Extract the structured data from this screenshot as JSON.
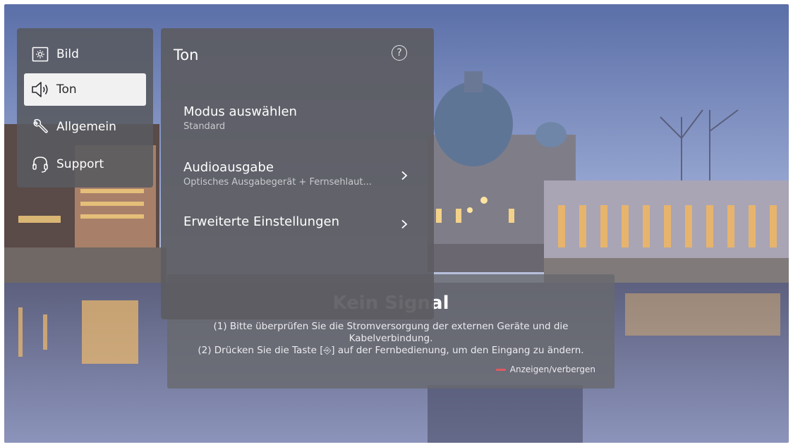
{
  "left_menu": {
    "items": [
      {
        "label": "Bild",
        "icon": "picture-settings-icon",
        "selected": false
      },
      {
        "label": "Ton",
        "icon": "speaker-icon",
        "selected": true
      },
      {
        "label": "Allgemein",
        "icon": "wrench-icon",
        "selected": false
      },
      {
        "label": "Support",
        "icon": "headset-icon",
        "selected": false
      }
    ]
  },
  "panel": {
    "title": "Ton",
    "help_glyph": "?",
    "rows": [
      {
        "label": "Modus auswählen",
        "value": "Standard",
        "has_arrow": false
      },
      {
        "label": "Audioausgabe",
        "value": "Optisches Ausgabegerät + Fernsehlaut...",
        "has_arrow": true
      },
      {
        "label": "Erweiterte Einstellungen",
        "value": "",
        "has_arrow": true
      }
    ]
  },
  "no_signal": {
    "title": "Kein Signal",
    "line1": "(1) Bitte überprüfen Sie die Stromversorgung der externen Geräte und die Kabelverbindung.",
    "line2": "(2) Drücken Sie die Taste [⎆] auf der Fernbedienung, um den Eingang zu ändern.",
    "toggle_label": "Anzeigen/verbergen",
    "toggle_color": "#e05a5f"
  },
  "colors": {
    "menu_bg": "#585a60",
    "selected_bg": "#f1f1f2",
    "panel_bg": "#5c5d62"
  }
}
